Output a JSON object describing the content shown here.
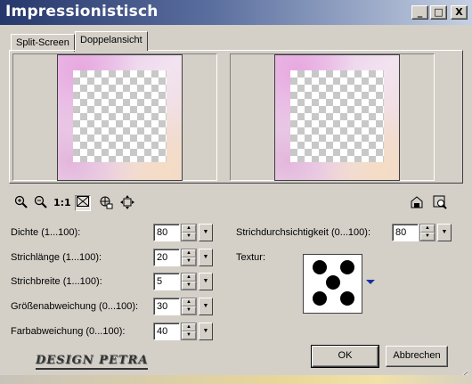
{
  "window": {
    "title": "Impressionistisch",
    "buttons": {
      "minimize": "_",
      "maximize": "□",
      "close": "X"
    }
  },
  "tabs": [
    {
      "label": "Split-Screen",
      "active": false
    },
    {
      "label": "Doppelansicht",
      "active": true
    }
  ],
  "toolbar": {
    "zoom_in": "zoom-in-icon",
    "zoom_out": "zoom-out-icon",
    "actual_size_label": "1:1",
    "fit_view": "fit-to-window-icon",
    "navigate": "navigate-icon",
    "pan": "pan-icon",
    "right_a": "proof-icon",
    "right_b": "preview-zoom-icon"
  },
  "params_left": [
    {
      "label": "Dichte (1...100):",
      "value": "80"
    },
    {
      "label": "Strichlänge (1...100):",
      "value": "20"
    },
    {
      "label": "Strichbreite (1...100):",
      "value": "5"
    },
    {
      "label": "Größenabweichung (0...100):",
      "value": "30"
    },
    {
      "label": "Farbabweichung (0...100):",
      "value": "40"
    }
  ],
  "params_right": [
    {
      "label": "Strichdurchsichtigkeit (0...100):",
      "value": "80"
    }
  ],
  "texture": {
    "label": "Textur:"
  },
  "spinner_glyphs": {
    "up": "▲",
    "down": "▼",
    "menu": "▼"
  },
  "buttons": {
    "ok": "OK",
    "cancel": "Abbrechen"
  },
  "logo": "DESIGN PETRA",
  "colors": {
    "title_start": "#26376b",
    "title_end": "#c5d0e3",
    "face": "#d4d0c8"
  }
}
